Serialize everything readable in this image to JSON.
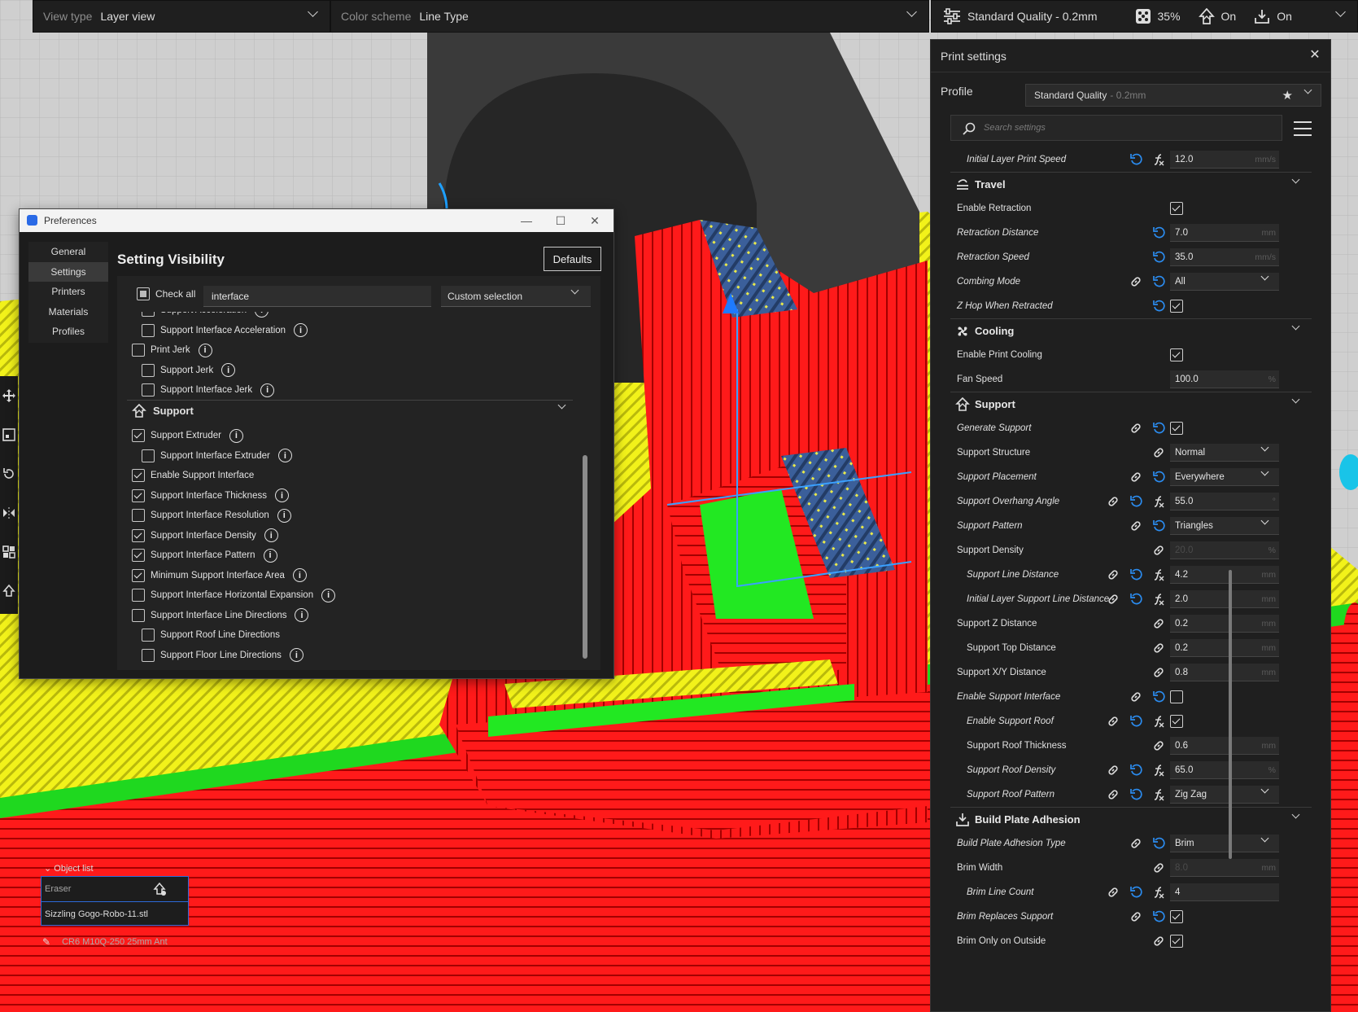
{
  "topbar": {
    "view_type_label": "View type",
    "view_type_value": "Layer view",
    "color_scheme_label": "Color scheme",
    "color_scheme_value": "Line Type",
    "profile": "Standard Quality - 0.2mm",
    "infill": "35%",
    "support": "On",
    "adhesion": "On"
  },
  "print_settings": {
    "title": "Print settings",
    "profile_label": "Profile",
    "profile_name": "Standard Quality",
    "profile_sub": "- 0.2mm",
    "search_placeholder": "Search settings",
    "rows": [
      {
        "type": "row",
        "name": "Initial Layer Print Speed",
        "indent": true,
        "mod": true,
        "icons": [
          "reset",
          "fx"
        ],
        "value": "12.0",
        "unit": "mm/s"
      },
      {
        "type": "cat",
        "name": "Travel",
        "icon": "travel"
      },
      {
        "type": "row",
        "name": "Enable Retraction",
        "check": true,
        "icons": []
      },
      {
        "type": "row",
        "name": "Retraction Distance",
        "mod": true,
        "icons": [
          "reset"
        ],
        "value": "7.0",
        "unit": "mm"
      },
      {
        "type": "row",
        "name": "Retraction Speed",
        "mod": true,
        "icons": [
          "reset"
        ],
        "value": "35.0",
        "unit": "mm/s"
      },
      {
        "type": "row",
        "name": "Combing Mode",
        "mod": true,
        "icons": [
          "link",
          "reset"
        ],
        "value": "All",
        "dropdown": true
      },
      {
        "type": "row",
        "name": "Z Hop When Retracted",
        "mod": true,
        "icons": [
          "reset"
        ],
        "check": true
      },
      {
        "type": "cat",
        "name": "Cooling",
        "icon": "cooling"
      },
      {
        "type": "row",
        "name": "Enable Print Cooling",
        "check": true,
        "icons": []
      },
      {
        "type": "row",
        "name": "Fan Speed",
        "icons": [],
        "value": "100.0",
        "unit": "%"
      },
      {
        "type": "cat",
        "name": "Support",
        "icon": "support"
      },
      {
        "type": "row",
        "name": "Generate Support",
        "mod": true,
        "icons": [
          "link",
          "reset"
        ],
        "check": true
      },
      {
        "type": "row",
        "name": "Support Structure",
        "icons": [
          "link"
        ],
        "value": "Normal",
        "dropdown": true
      },
      {
        "type": "row",
        "name": "Support Placement",
        "mod": true,
        "icons": [
          "link",
          "reset"
        ],
        "value": "Everywhere",
        "dropdown": true
      },
      {
        "type": "row",
        "name": "Support Overhang Angle",
        "mod": true,
        "icons": [
          "link",
          "reset",
          "fx"
        ],
        "value": "55.0",
        "unit": "°"
      },
      {
        "type": "row",
        "name": "Support Pattern",
        "mod": true,
        "icons": [
          "link",
          "reset"
        ],
        "value": "Triangles",
        "dropdown": true
      },
      {
        "type": "row",
        "name": "Support Density",
        "icons": [
          "link"
        ],
        "value": "20.0",
        "unit": "%",
        "disabled": true
      },
      {
        "type": "row",
        "name": "Support Line Distance",
        "indent": true,
        "mod": true,
        "icons": [
          "link",
          "reset",
          "fx"
        ],
        "value": "4.2",
        "unit": "mm"
      },
      {
        "type": "row",
        "name": "Initial Layer Support Line Distance",
        "indent": true,
        "mod": true,
        "icons": [
          "link",
          "reset",
          "fx"
        ],
        "value": "2.0",
        "unit": "mm"
      },
      {
        "type": "row",
        "name": "Support Z Distance",
        "icons": [
          "link"
        ],
        "value": "0.2",
        "unit": "mm"
      },
      {
        "type": "row",
        "name": "Support Top Distance",
        "indent": true,
        "icons": [
          "link"
        ],
        "value": "0.2",
        "unit": "mm"
      },
      {
        "type": "row",
        "name": "Support X/Y Distance",
        "icons": [
          "link"
        ],
        "value": "0.8",
        "unit": "mm"
      },
      {
        "type": "row",
        "name": "Enable Support Interface",
        "mod": true,
        "icons": [
          "link",
          "reset"
        ],
        "check": false
      },
      {
        "type": "row",
        "name": "Enable Support Roof",
        "indent": true,
        "mod": true,
        "icons": [
          "link",
          "reset",
          "fx"
        ],
        "check": true
      },
      {
        "type": "row",
        "name": "Support Roof Thickness",
        "indent": true,
        "icons": [
          "link"
        ],
        "value": "0.6",
        "unit": "mm"
      },
      {
        "type": "row",
        "name": "Support Roof Density",
        "indent": true,
        "mod": true,
        "icons": [
          "link",
          "reset",
          "fx"
        ],
        "value": "65.0",
        "unit": "%"
      },
      {
        "type": "row",
        "name": "Support Roof Pattern",
        "indent": true,
        "mod": true,
        "icons": [
          "link",
          "reset",
          "fx"
        ],
        "value": "Zig Zag",
        "dropdown": true
      },
      {
        "type": "cat",
        "name": "Build Plate Adhesion",
        "icon": "adhesion"
      },
      {
        "type": "row",
        "name": "Build Plate Adhesion Type",
        "mod": true,
        "icons": [
          "link",
          "reset"
        ],
        "value": "Brim",
        "dropdown": true
      },
      {
        "type": "row",
        "name": "Brim Width",
        "icons": [
          "link"
        ],
        "value": "8.0",
        "unit": "mm",
        "disabled": true
      },
      {
        "type": "row",
        "name": "Brim Line Count",
        "indent": true,
        "mod": true,
        "icons": [
          "link",
          "reset",
          "fx"
        ],
        "value": "4"
      },
      {
        "type": "row",
        "name": "Brim Replaces Support",
        "mod": true,
        "icons": [
          "link",
          "reset"
        ],
        "check": true
      },
      {
        "type": "row",
        "name": "Brim Only on Outside",
        "icons": [
          "link"
        ],
        "check": true
      }
    ]
  },
  "preferences": {
    "title": "Preferences",
    "nav": [
      "General",
      "Settings",
      "Printers",
      "Materials",
      "Profiles"
    ],
    "active_nav": "Settings",
    "heading": "Setting Visibility",
    "defaults_label": "Defaults",
    "check_all_label": "Check all",
    "filter_value": "interface",
    "selection": "Custom selection",
    "items_top": [
      {
        "label": "Support Acceleration",
        "checked": false,
        "indent": true,
        "info": true
      },
      {
        "label": "Support Interface Acceleration",
        "checked": false,
        "indent": true,
        "info": true
      },
      {
        "label": "Print Jerk",
        "checked": false,
        "indent": false,
        "info": true
      },
      {
        "label": "Support Jerk",
        "checked": false,
        "indent": true,
        "info": true
      },
      {
        "label": "Support Interface Jerk",
        "checked": false,
        "indent": true,
        "info": true
      }
    ],
    "support_category": "Support",
    "items_support": [
      {
        "label": "Support Extruder",
        "checked": true,
        "indent": false,
        "info": true
      },
      {
        "label": "Support Interface Extruder",
        "checked": false,
        "indent": true,
        "info": true
      },
      {
        "label": "Enable Support Interface",
        "checked": true,
        "indent": false,
        "info": false
      },
      {
        "label": "Support Interface Thickness",
        "checked": true,
        "indent": false,
        "info": true
      },
      {
        "label": "Support Interface Resolution",
        "checked": false,
        "indent": false,
        "info": true
      },
      {
        "label": "Support Interface Density",
        "checked": true,
        "indent": false,
        "info": true
      },
      {
        "label": "Support Interface Pattern",
        "checked": true,
        "indent": false,
        "info": true
      },
      {
        "label": "Minimum Support Interface Area",
        "checked": true,
        "indent": false,
        "info": true
      },
      {
        "label": "Support Interface Horizontal Expansion",
        "checked": false,
        "indent": false,
        "info": true
      },
      {
        "label": "Support Interface Line Directions",
        "checked": false,
        "indent": false,
        "info": true
      },
      {
        "label": "Support Roof Line Directions",
        "checked": false,
        "indent": true,
        "info": false
      },
      {
        "label": "Support Floor Line Directions",
        "checked": false,
        "indent": true,
        "info": true
      }
    ]
  },
  "object_list": {
    "header": "Object list",
    "items": [
      "Eraser",
      "Sizzling Gogo-Robo-11.stl"
    ],
    "footer": "CR6 M10Q-250 25mm Ant"
  },
  "colors": {
    "accent": "#2b6ad9",
    "wall_red": "#ff1a1a",
    "infill_yellow": "#f2f21a",
    "skin_green": "#22e822",
    "support_blue": "#3b5f9a",
    "panel_bg": "#1f1f1f"
  }
}
